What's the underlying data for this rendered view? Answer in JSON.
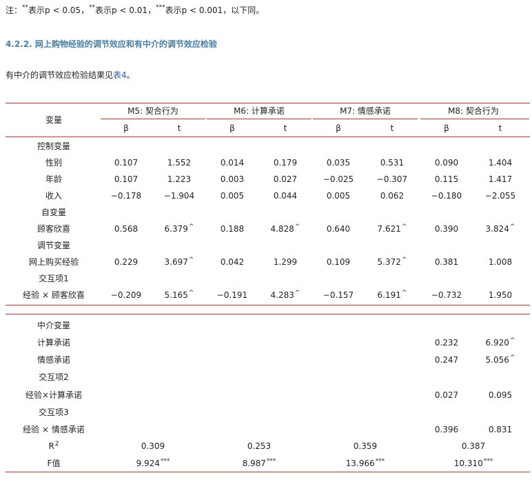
{
  "note": {
    "prefix": "注：",
    "s1": "**",
    "t1": "表示p < 0.05，",
    "s2": "**",
    "t2": "表示p < 0.01，",
    "s3": "***",
    "t3": "表示p < 0.001，以下同。"
  },
  "heading": "4.2.2. 网上购物经验的调节效应和有中介的调节效应检验",
  "intro": {
    "text": "有中介的调节效应检验结果见",
    "link": "表4",
    "end": "。"
  },
  "table": {
    "var_header": "变量",
    "models": [
      "M5: 契合行为",
      "M6: 计算承诺",
      "M7: 情感承诺",
      "M8: 契合行为"
    ],
    "sub_headers": [
      "β",
      "t",
      "β",
      "t",
      "β",
      "t",
      "β",
      "t"
    ],
    "rows": [
      {
        "label": "控制变量",
        "cells": [
          "",
          "",
          "",
          "",
          "",
          "",
          "",
          ""
        ]
      },
      {
        "label": "性别",
        "cells": [
          "0.107",
          "1.552",
          "0.014",
          "0.179",
          "0.035",
          "0.531",
          "0.090",
          "1.404"
        ]
      },
      {
        "label": "年龄",
        "cells": [
          "0.107",
          "1.223",
          "0.003",
          "0.027",
          "−0.025",
          "−0.307",
          "0.115",
          "1.417"
        ]
      },
      {
        "label": "收入",
        "cells": [
          "−0.178",
          "−1.904",
          "0.005",
          "0.044",
          "0.005",
          "0.062",
          "−0.180",
          "−2.055"
        ]
      },
      {
        "label": "自变量",
        "cells": [
          "",
          "",
          "",
          "",
          "",
          "",
          "",
          ""
        ]
      },
      {
        "label": "顾客欣喜",
        "cells": [
          "0.568",
          "6.379",
          "0.188",
          "4.828",
          "0.640",
          "7.621",
          "0.390",
          "3.824"
        ],
        "sups": [
          "",
          "^",
          "",
          "^",
          "",
          "^",
          "",
          "^"
        ]
      },
      {
        "label": "调节变量",
        "cells": [
          "",
          "",
          "",
          "",
          "",
          "",
          "",
          ""
        ]
      },
      {
        "label": "网上购买经验",
        "cells": [
          "0.229",
          "3.697",
          "0.042",
          "1.299",
          "0.109",
          "5.372",
          "0.381",
          "1.008"
        ],
        "sups": [
          "",
          "^",
          "",
          "",
          "",
          "^",
          "",
          ""
        ]
      },
      {
        "label": "交互项1",
        "cells": [
          "",
          "",
          "",
          "",
          "",
          "",
          "",
          ""
        ]
      },
      {
        "label": "经验 × 顾客欣喜",
        "cells": [
          "−0.209",
          "5.165",
          "−0.191",
          "4.283",
          "−0.157",
          "6.191",
          "−0.732",
          "1.950"
        ],
        "sups": [
          "",
          "^",
          "",
          "^",
          "",
          "^",
          "",
          ""
        ]
      }
    ],
    "rows2": [
      {
        "label": "中介变量",
        "cells": [
          "",
          ""
        ]
      },
      {
        "label": "计算承诺",
        "cells": [
          "0.232",
          "6.920"
        ],
        "sups": [
          "",
          "^"
        ]
      },
      {
        "label": "情感承诺",
        "cells": [
          "0.247",
          "5.056"
        ],
        "sups": [
          "",
          "^"
        ]
      },
      {
        "label": "交互项2",
        "cells": [
          "",
          ""
        ]
      },
      {
        "label": "经验×计算承诺",
        "cells": [
          "0.027",
          "0.095"
        ]
      },
      {
        "label": "交互项3",
        "cells": [
          "",
          ""
        ]
      },
      {
        "label": "经验 × 情感承诺",
        "cells": [
          "0.396",
          "0.831"
        ]
      }
    ],
    "r2": {
      "label": "R",
      "sup": "2",
      "values": [
        "0.309",
        "0.253",
        "0.359",
        "0.387"
      ]
    },
    "f": {
      "label": "F值",
      "values": [
        "9.924",
        "8.987",
        "13.966",
        "10.310"
      ],
      "sup": "***"
    }
  }
}
